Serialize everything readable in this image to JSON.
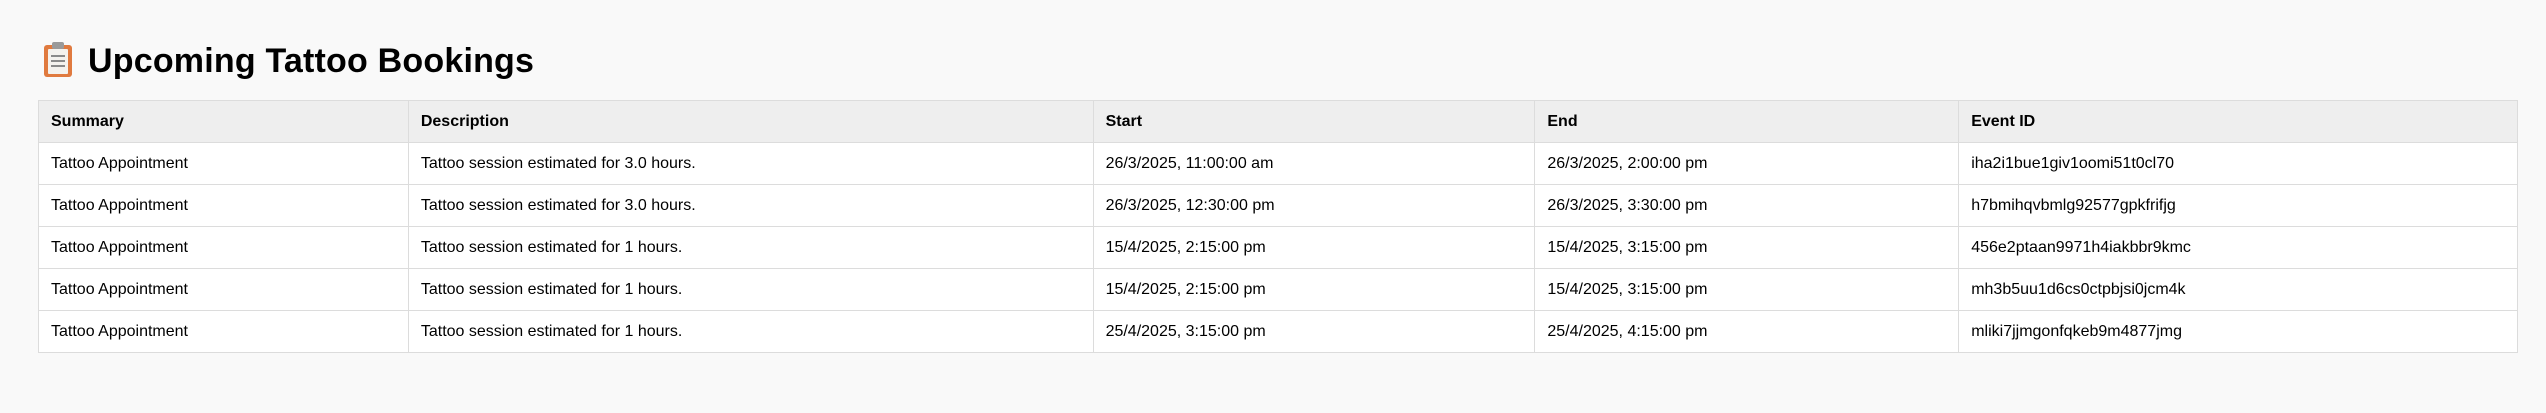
{
  "page": {
    "title": "Upcoming Tattoo Bookings",
    "icon": "clipboard-icon"
  },
  "table": {
    "headers": [
      "Summary",
      "Description",
      "Start",
      "End",
      "Event ID"
    ],
    "rows": [
      [
        "Tattoo Appointment",
        "Tattoo session estimated for 3.0 hours.",
        "26/3/2025, 11:00:00 am",
        "26/3/2025, 2:00:00 pm",
        "iha2i1bue1giv1oomi51t0cl70"
      ],
      [
        "Tattoo Appointment",
        "Tattoo session estimated for 3.0 hours.",
        "26/3/2025, 12:30:00 pm",
        "26/3/2025, 3:30:00 pm",
        "h7bmihqvbmlg92577gpkfrifjg"
      ],
      [
        "Tattoo Appointment",
        "Tattoo session estimated for 1 hours.",
        "15/4/2025, 2:15:00 pm",
        "15/4/2025, 3:15:00 pm",
        "456e2ptaan9971h4iakbbr9kmc"
      ],
      [
        "Tattoo Appointment",
        "Tattoo session estimated for 1 hours.",
        "15/4/2025, 2:15:00 pm",
        "15/4/2025, 3:15:00 pm",
        "mh3b5uu1d6cs0ctpbjsi0jcm4k"
      ],
      [
        "Tattoo Appointment",
        "Tattoo session estimated for 1 hours.",
        "25/4/2025, 3:15:00 pm",
        "25/4/2025, 4:15:00 pm",
        "mliki7jjmgonfqkeb9m4877jmg"
      ]
    ]
  },
  "colors": {
    "background": "#f9f9f9",
    "header_bg": "#eeeeee",
    "border": "#dcdcdc",
    "icon_accent": "#e07a3f"
  }
}
